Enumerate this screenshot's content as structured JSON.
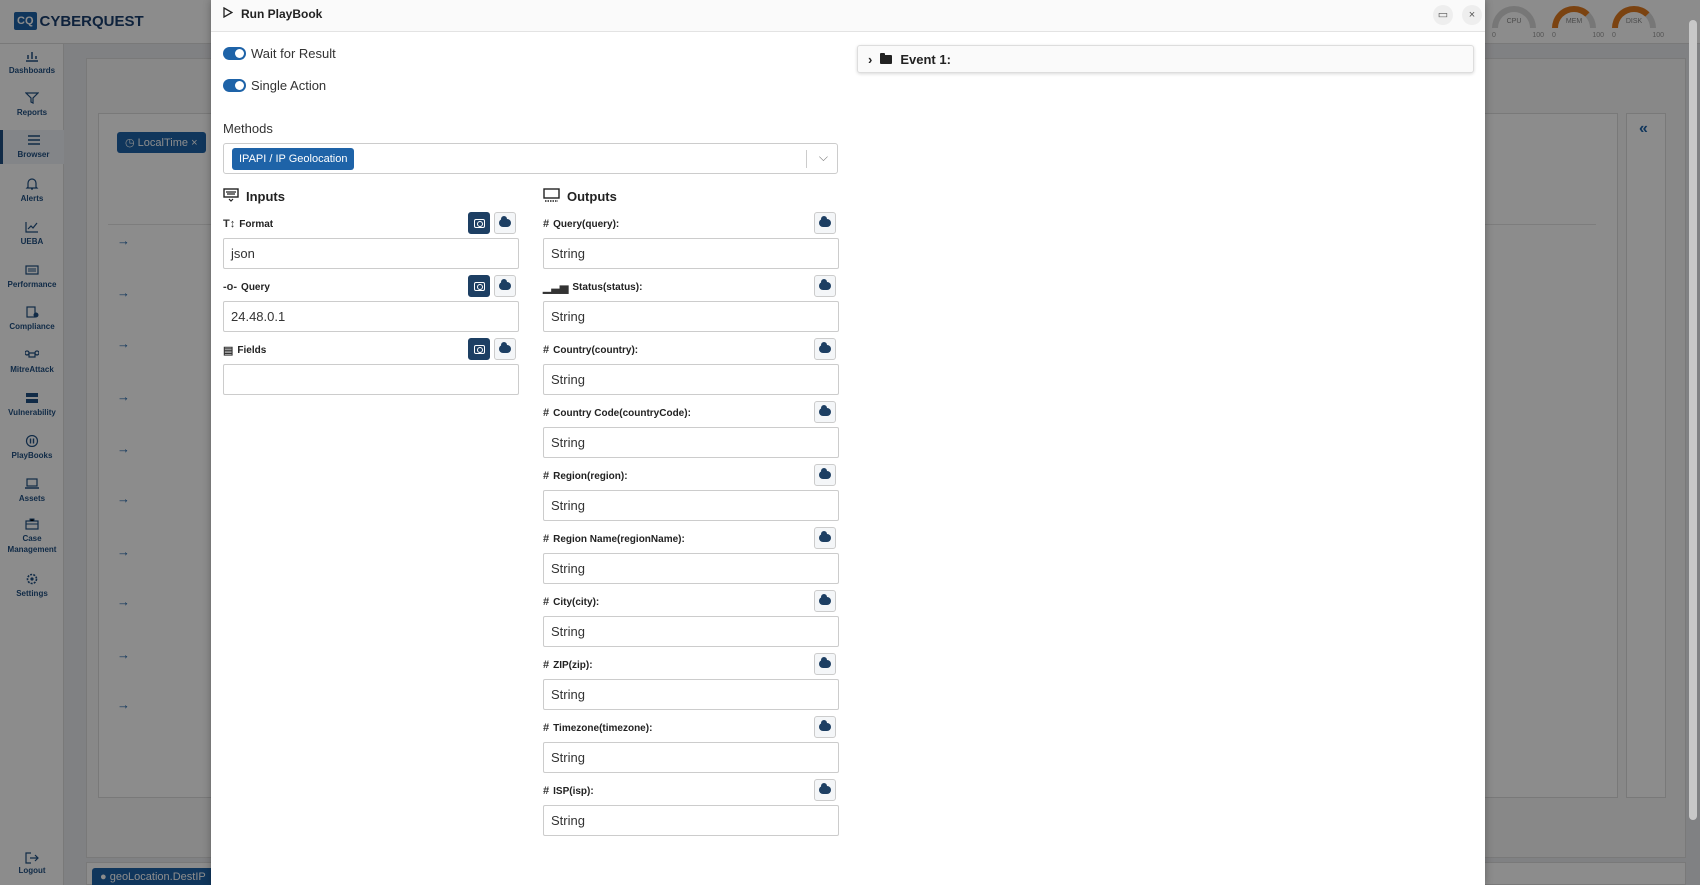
{
  "app": {
    "logo_mark": "CQ",
    "logo_text": "CYBERQUEST"
  },
  "gauges": [
    {
      "label": "CPU",
      "min": "0",
      "max": "100",
      "level": 0.1
    },
    {
      "label": "MEM",
      "min": "0",
      "max": "100",
      "level": 0.5
    },
    {
      "label": "DISK",
      "min": "0",
      "max": "100",
      "level": 0.5
    }
  ],
  "sidebar": {
    "items": [
      {
        "label": "Dashboards",
        "icon": "dashboard-icon"
      },
      {
        "label": "Reports",
        "icon": "filter-icon"
      },
      {
        "label": "Browser",
        "icon": "list-icon"
      },
      {
        "label": "Alerts",
        "icon": "bell-icon"
      },
      {
        "label": "UEBA",
        "icon": "chart-icon"
      },
      {
        "label": "Performance",
        "icon": "performance-icon"
      },
      {
        "label": "Compliance",
        "icon": "compliance-icon"
      },
      {
        "label": "MitreAttack",
        "icon": "command-icon"
      },
      {
        "label": "Vulnerability",
        "icon": "vulnerability-icon"
      },
      {
        "label": "PlayBooks",
        "icon": "playbooks-icon"
      },
      {
        "label": "Assets",
        "icon": "laptop-icon"
      },
      {
        "label": "Case Management",
        "icon": "briefcase-icon"
      },
      {
        "label": "Settings",
        "icon": "gear-icon"
      }
    ],
    "logout_label": "Logout"
  },
  "background": {
    "filter_chip": "LocalTime",
    "bottom_chip": "geoLocation.DestIP"
  },
  "modal": {
    "title": "Run PlayBook",
    "wait_for_result_label": "Wait for Result",
    "single_action_label": "Single Action",
    "methods_label": "Methods",
    "method_selected": "IPAPI / IP Geolocation",
    "inputs_title": "Inputs",
    "outputs_title": "Outputs",
    "event_title": "Event 1:",
    "inputs": [
      {
        "label": "Format",
        "value": "json"
      },
      {
        "label": "Query",
        "value": "24.48.0.1"
      },
      {
        "label": "Fields",
        "value": ""
      }
    ],
    "outputs": [
      {
        "label": "Query(query):",
        "value": "String"
      },
      {
        "label": "Status(status):",
        "value": "String"
      },
      {
        "label": "Country(country):",
        "value": "String"
      },
      {
        "label": "Country Code(countryCode):",
        "value": "String"
      },
      {
        "label": "Region(region):",
        "value": "String"
      },
      {
        "label": "Region Name(regionName):",
        "value": "String"
      },
      {
        "label": "City(city):",
        "value": "String"
      },
      {
        "label": "ZIP(zip):",
        "value": "String"
      },
      {
        "label": "Timezone(timezone):",
        "value": "String"
      },
      {
        "label": "ISP(isp):",
        "value": "String"
      }
    ]
  },
  "colors": {
    "accent": "#1e63a8",
    "dark_button": "#1d3f63",
    "gauge_hot": "#e07a1f"
  }
}
